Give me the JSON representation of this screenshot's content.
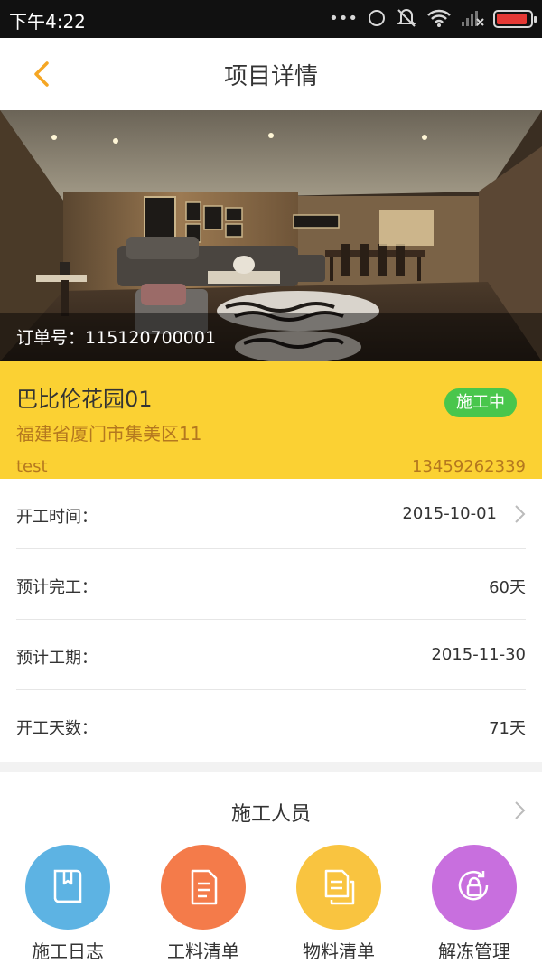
{
  "status_bar": {
    "time": "下午4:22",
    "battery_level": 0.92,
    "battery_color": "#e53935"
  },
  "header": {
    "title": "项目详情",
    "back_icon": "chevron-left-icon",
    "accent_color": "#f5a623"
  },
  "hero": {
    "order_label": "订单号：",
    "order_number": "115120700001"
  },
  "project": {
    "name": "巴比伦花园01",
    "address": "福建省厦门市集美区11",
    "owner": "test",
    "phone": "13459262339",
    "status": "施工中",
    "card_color": "#fbd133",
    "status_color": "#49c64c"
  },
  "info_rows": [
    {
      "label": "开工时间：",
      "value": "2015-10-01"
    },
    {
      "label": "预计完工：",
      "value": "60天"
    },
    {
      "label": "预计工期：",
      "value": "2015-11-30"
    },
    {
      "label": "开工天数：",
      "value": "71天"
    }
  ],
  "workers": {
    "title": "施工人员"
  },
  "actions": [
    {
      "label": "施工日志",
      "icon": "book-icon",
      "color": "#5db3e3"
    },
    {
      "label": "工料清单",
      "icon": "document-list-icon",
      "color": "#f47b4a"
    },
    {
      "label": "物料清单",
      "icon": "copy-documents-icon",
      "color": "#f9c440"
    },
    {
      "label": "解冻管理",
      "icon": "lock-refresh-icon",
      "color": "#c86fde"
    }
  ]
}
